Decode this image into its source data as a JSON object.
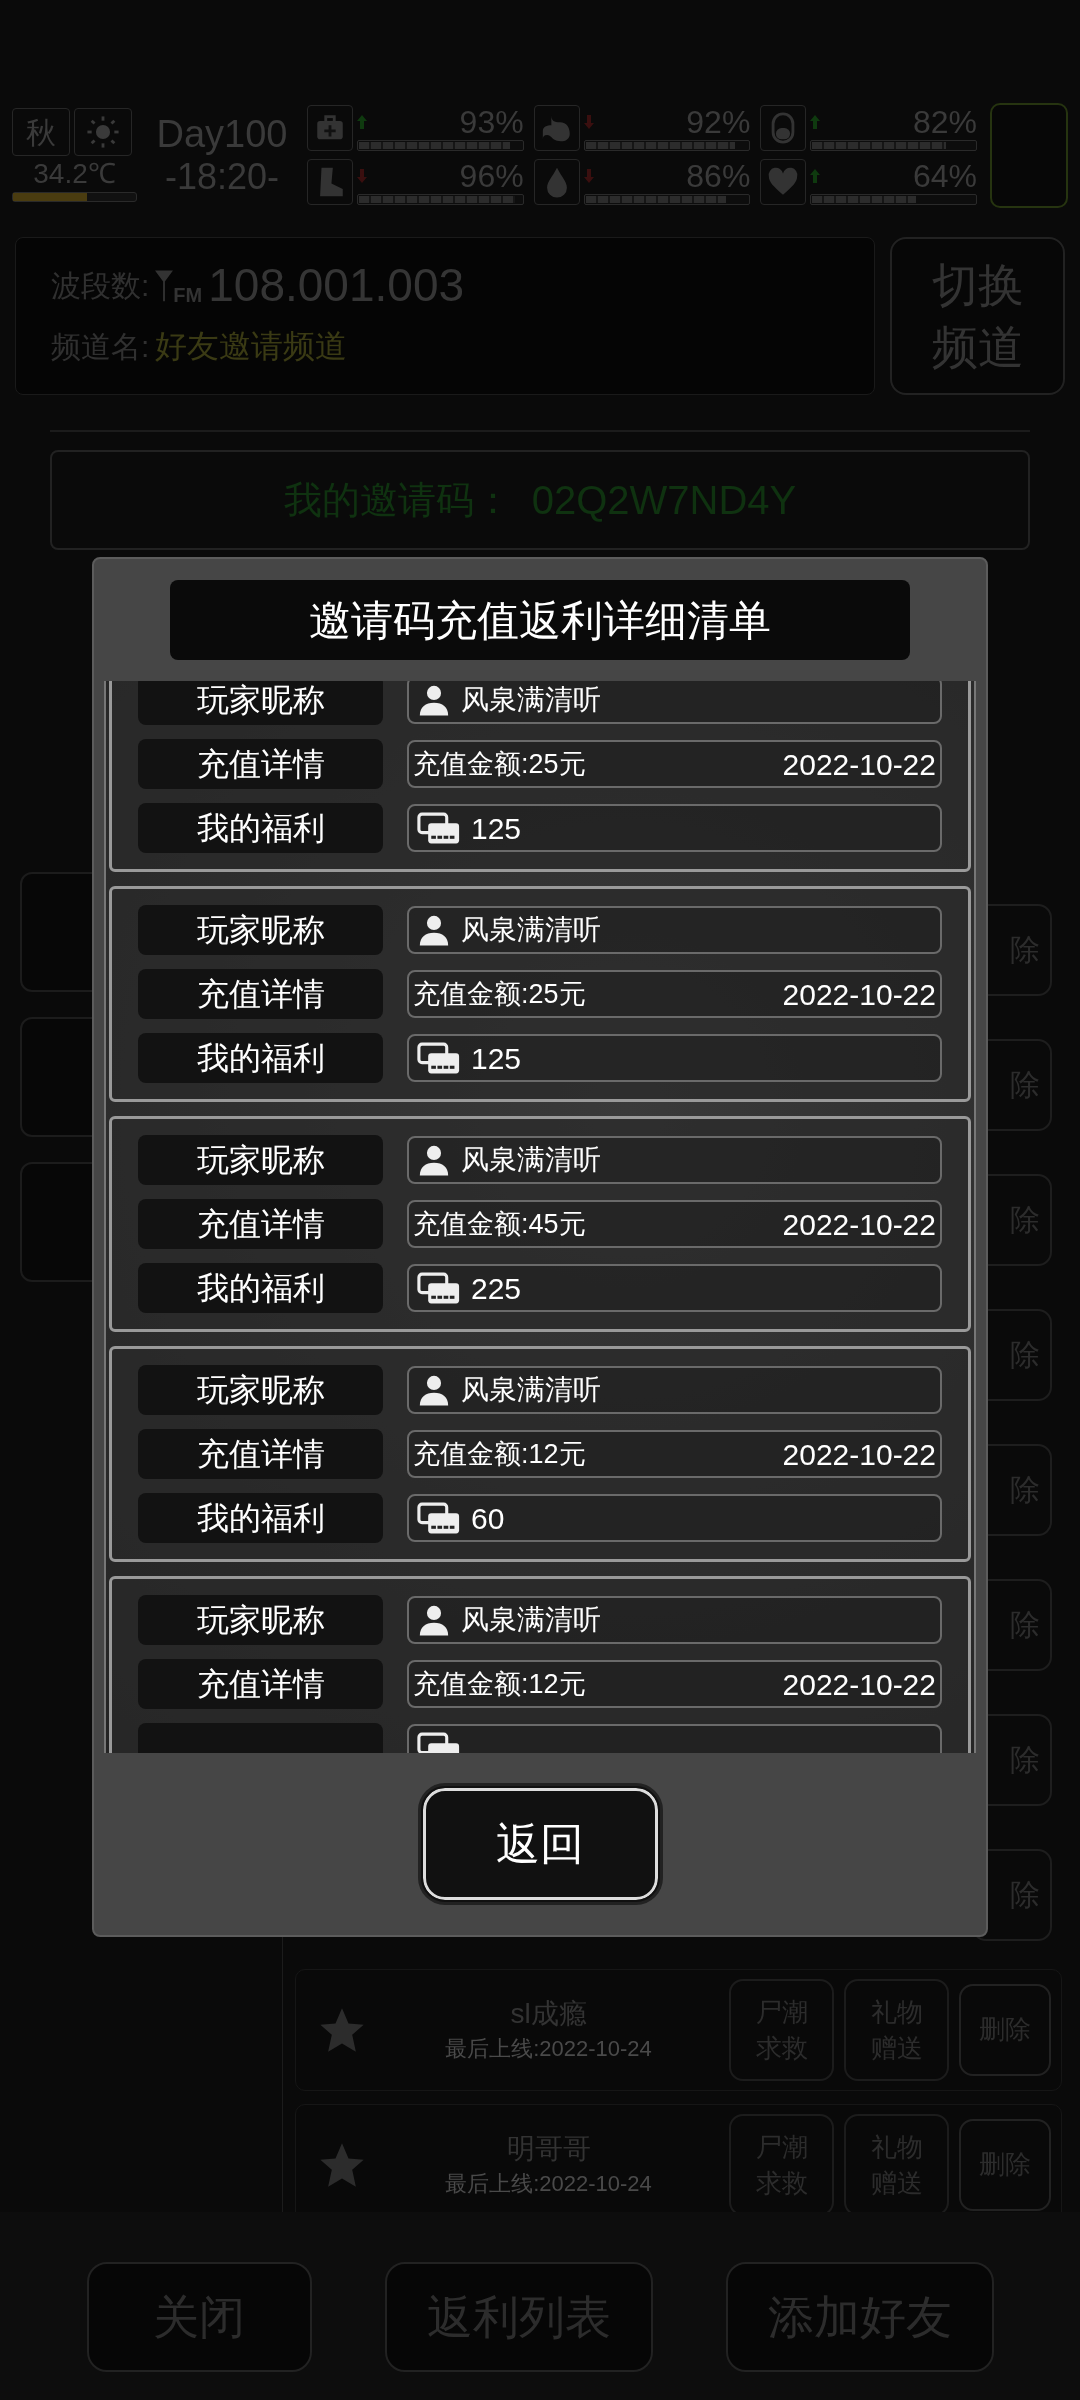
{
  "status_bar": {
    "season": "秋",
    "temperature": {
      "text": "34.2℃",
      "level": 0.6
    },
    "day": "Day100",
    "time": "-18:20-",
    "stats": [
      {
        "kind": "medkit",
        "rising": true,
        "reading": "93%",
        "level": 0.93
      },
      {
        "kind": "stomach",
        "rising": false,
        "reading": "92%",
        "level": 0.92
      },
      {
        "kind": "capsule",
        "rising": true,
        "reading": "82%",
        "level": 0.82
      },
      {
        "kind": "boot",
        "rising": false,
        "reading": "96%",
        "level": 0.96
      },
      {
        "kind": "drop",
        "rising": false,
        "reading": "86%",
        "level": 0.86
      },
      {
        "kind": "heart",
        "rising": true,
        "reading": "64%",
        "level": 0.64
      }
    ]
  },
  "channel": {
    "band_label": "波段数:",
    "fm_mark": "FM",
    "band": "108.001.003",
    "name_label": "频道名:",
    "name": "好友邀请频道",
    "switch_button": "切换频道"
  },
  "invite": {
    "label": "我的邀请码：",
    "code": "02Q2W7ND4Y"
  },
  "friends": [
    {
      "kind": "covered",
      "delete": "除"
    },
    {
      "kind": "covered",
      "delete": "除"
    },
    {
      "kind": "covered",
      "delete": "除"
    },
    {
      "kind": "covered",
      "delete": "除"
    },
    {
      "kind": "covered",
      "delete": "除"
    },
    {
      "kind": "covered",
      "delete": "除"
    },
    {
      "kind": "covered",
      "delete": "除"
    },
    {
      "kind": "covered",
      "delete": "除"
    },
    {
      "kind": "full",
      "name": "sl成瘾",
      "last_online": "最后上线:2022-10-24",
      "actions": [
        "尸潮求救",
        "礼物赠送"
      ],
      "delete": "删除"
    },
    {
      "kind": "full",
      "name": "明哥哥",
      "last_online": "最后上线:2022-10-24",
      "actions": [
        "尸潮求救",
        "礼物赠送"
      ],
      "delete": "删除"
    }
  ],
  "bottom_buttons": [
    "关闭",
    "返利列表",
    "添加好友"
  ],
  "modal": {
    "title": "邀请码充值返利详细清单",
    "records": [
      {
        "nickname_label": "玩家昵称",
        "nickname": "风泉满清听",
        "detail_label": "充值详情",
        "amount": "充值金额:25元",
        "date": "2022-10-22",
        "bonus_label": "我的福利",
        "bonus": "125"
      },
      {
        "nickname_label": "玩家昵称",
        "nickname": "风泉满清听",
        "detail_label": "充值详情",
        "amount": "充值金额:25元",
        "date": "2022-10-22",
        "bonus_label": "我的福利",
        "bonus": "125"
      },
      {
        "nickname_label": "玩家昵称",
        "nickname": "风泉满清听",
        "detail_label": "充值详情",
        "amount": "充值金额:45元",
        "date": "2022-10-22",
        "bonus_label": "我的福利",
        "bonus": "225"
      },
      {
        "nickname_label": "玩家昵称",
        "nickname": "风泉满清听",
        "detail_label": "充值详情",
        "amount": "充值金额:12元",
        "date": "2022-10-22",
        "bonus_label": "我的福利",
        "bonus": "60"
      },
      {
        "nickname_label": "玩家昵称",
        "nickname": "风泉满清听",
        "detail_label": "充值详情",
        "amount": "充值金额:12元",
        "date": "2022-10-22"
      }
    ],
    "back_button": "返回"
  }
}
